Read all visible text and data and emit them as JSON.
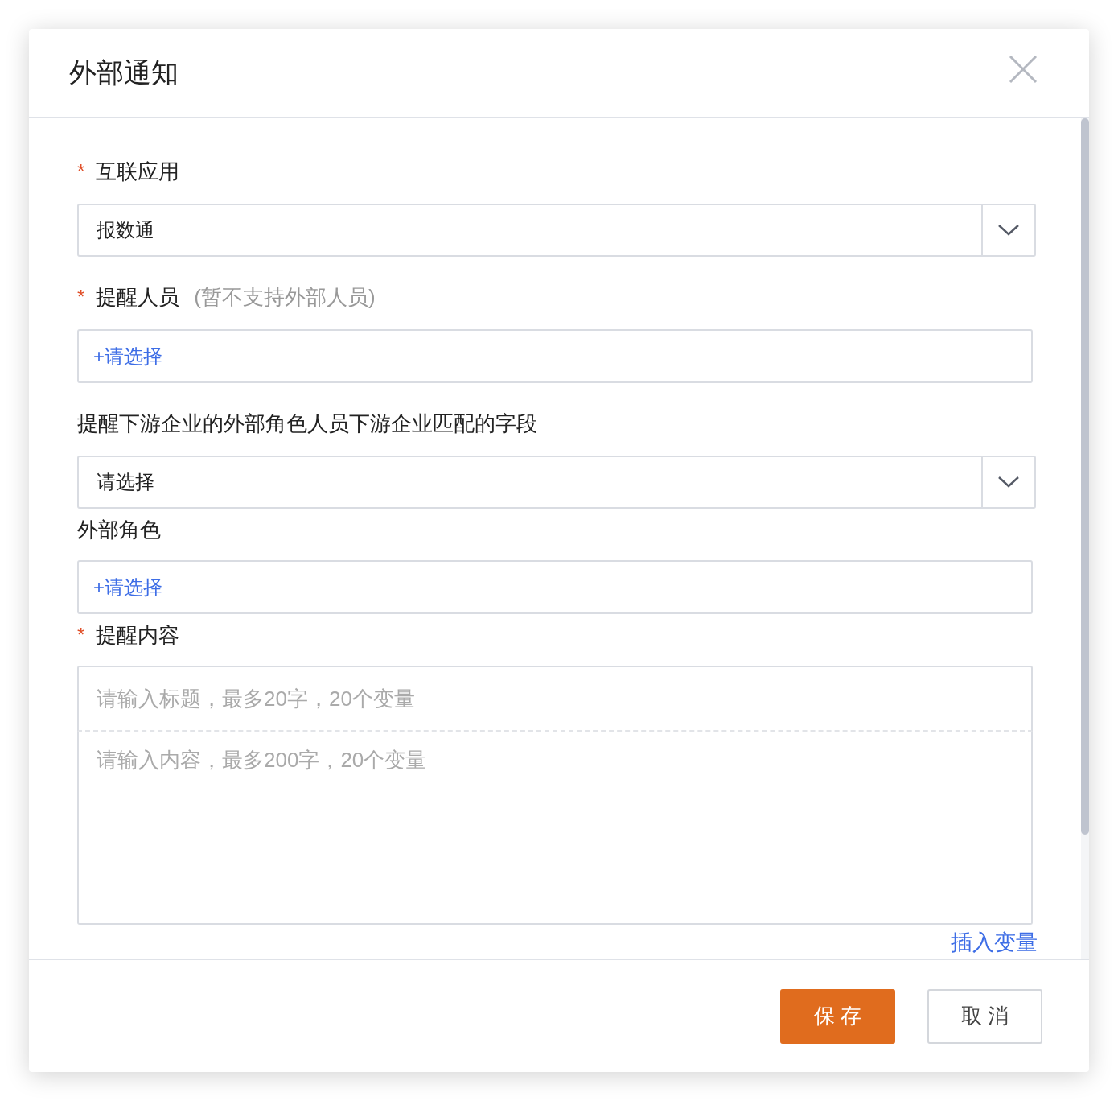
{
  "dialog": {
    "title": "外部通知"
  },
  "fields": [
    {
      "kind": "select",
      "marker": "*",
      "label": "互联应用",
      "value": "报数通"
    },
    {
      "kind": "picker",
      "marker": "*",
      "label": "提醒人员",
      "note": "(暂不支持外部人员)",
      "action": "+请选择"
    },
    {
      "kind": "select",
      "label": "提醒下游企业的外部角色人员下游企业匹配的字段",
      "value": "请选择"
    },
    {
      "kind": "picker",
      "label": "外部角色",
      "action": "+请选择"
    },
    {
      "kind": "editor",
      "marker": "*",
      "label": "提醒内容",
      "title_placeholder": "请输入标题，最多20字，20个变量",
      "content_placeholder": "请输入内容，最多200字，20个变量",
      "link": "插入变量"
    }
  ],
  "buttons": [
    {
      "label": "保 存",
      "primary": true
    },
    {
      "label": "取 消",
      "primary": false
    }
  ]
}
